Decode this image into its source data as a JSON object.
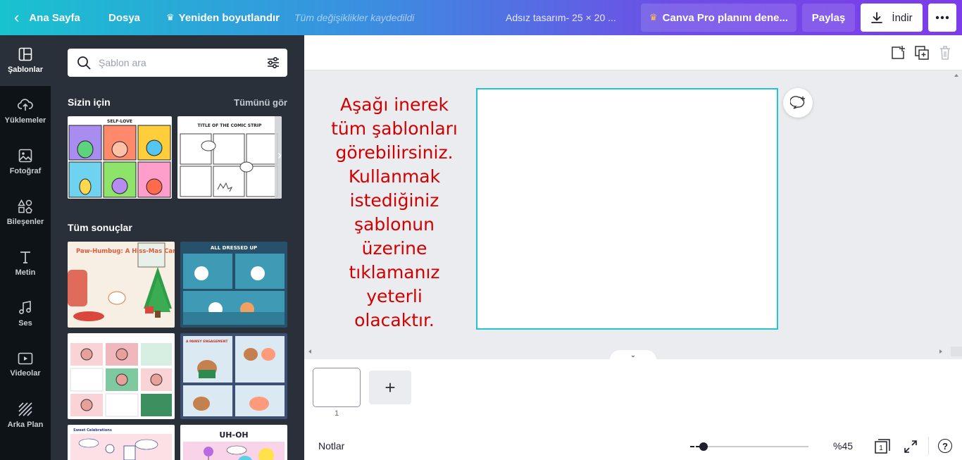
{
  "topbar": {
    "home": "Ana Sayfa",
    "file": "Dosya",
    "resize": "Yeniden boyutlandır",
    "saved_status": "Tüm değişiklikler kaydedildi",
    "design_title": "Adsız tasarım- 25 × 20 ...",
    "pro_trial": "Canva Pro planını dene...",
    "share": "Paylaş",
    "download": "İndir"
  },
  "rail": {
    "items": [
      {
        "label": "Şablonlar",
        "icon": "templates-icon"
      },
      {
        "label": "Yüklemeler",
        "icon": "upload-cloud-icon"
      },
      {
        "label": "Fotoğraf",
        "icon": "photo-icon"
      },
      {
        "label": "Bileşenler",
        "icon": "elements-icon"
      },
      {
        "label": "Metin",
        "icon": "text-icon"
      },
      {
        "label": "Ses",
        "icon": "music-note-icon"
      },
      {
        "label": "Videolar",
        "icon": "video-icon"
      },
      {
        "label": "Arka Plan",
        "icon": "background-pattern-icon"
      }
    ]
  },
  "panel": {
    "search_placeholder": "Şablon ara",
    "for_you_title": "Sizin için",
    "see_all": "Tümünü gör",
    "all_results_title": "Tüm sonuçlar",
    "templates": {
      "self_love": {
        "title": "SELF-LOVE"
      },
      "comic_strip": {
        "title": "TITLE OF THE COMIC STRIP"
      },
      "paw_humbug": {
        "title": "Paw-Humbug: A Hiss-Mas Carol"
      },
      "all_dressed_up": {
        "title": "ALL DRESSED UP"
      },
      "pug_comic": {
        "title": ""
      },
      "pawsy_engagement": {
        "title": "A PAWSY ENGAGEMENT"
      },
      "sweet_celebrations": {
        "title": "Sweet Celebrations"
      },
      "uh_oh": {
        "title": "UH-OH"
      }
    }
  },
  "canvas": {
    "instruction": "Aşağı inerek tüm şablonları görebilirsiniz. Kullanmak istediğiniz şablonun üzerine tıklamanız yeterli olacaktır."
  },
  "tray": {
    "page_number": "1"
  },
  "footer": {
    "notes": "Notlar",
    "zoom_label": "%45",
    "zoom_fraction": 0.07,
    "page_count": "1"
  },
  "colors": {
    "accent_cyan": "#21c6d6",
    "instruction_red": "#d40000",
    "panel_bg": "#293039",
    "rail_bg": "#0e1318"
  }
}
